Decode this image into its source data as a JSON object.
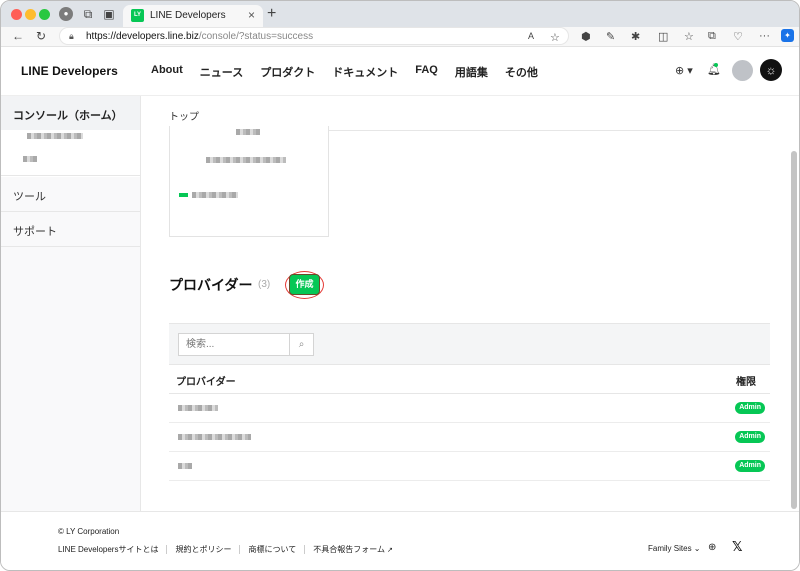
{
  "browser": {
    "tab_title": "LINE Developers",
    "tab_favicon": "LY",
    "url_host": "https://developers.line.biz",
    "url_path": "/console/?status=success"
  },
  "site": {
    "logo": "LINE Developers",
    "nav": [
      "About",
      "ニュース",
      "プロダクト",
      "ドキュメント",
      "FAQ",
      "用語集",
      "その他"
    ]
  },
  "sidebar": {
    "home": "コンソール（ホーム）",
    "tools": "ツール",
    "support": "サポート"
  },
  "main": {
    "breadcrumb": "トップ",
    "providers_title": "プロバイダー",
    "providers_count": "(3)",
    "create_label": "作成",
    "search_placeholder": "検索...",
    "table_headers": {
      "name": "プロバイダー",
      "role": "権限"
    },
    "rows": [
      {
        "role": "Admin"
      },
      {
        "role": "Admin"
      },
      {
        "role": "Admin"
      }
    ]
  },
  "footer": {
    "copyright": "© LY Corporation",
    "links": [
      "LINE Developersサイトとは",
      "規約とポリシー",
      "商標について",
      "不具合報告フォーム"
    ],
    "family_sites": "Family Sites"
  },
  "colors": {
    "accent": "#06c755",
    "highlight_ring": "#e53935"
  }
}
